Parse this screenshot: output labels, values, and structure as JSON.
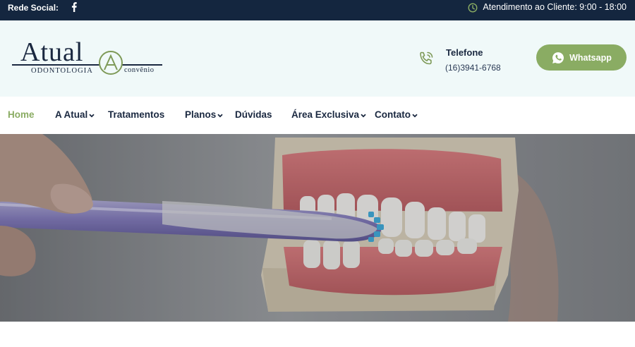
{
  "topbar": {
    "social_label": "Rede Social:",
    "social_icon": "facebook-icon",
    "support_icon": "clock-icon",
    "support_text": "Atendimento ao Cliente: 9:00 - 18:00"
  },
  "header": {
    "logo": {
      "brand": "Atual",
      "subtitle": "ODONTOLOGIA",
      "tagline": "convênio"
    },
    "phone": {
      "icon": "phone-icon",
      "title": "Telefone",
      "number": "(16)3941-6768"
    },
    "whatsapp": {
      "icon": "whatsapp-icon",
      "label": "Whatsapp"
    }
  },
  "nav": {
    "items": [
      {
        "label": "Home",
        "active": true,
        "dropdown": false
      },
      {
        "label": "A Atual",
        "active": false,
        "dropdown": true
      },
      {
        "label": "Tratamentos",
        "active": false,
        "dropdown": false
      },
      {
        "label": "Planos",
        "active": false,
        "dropdown": true
      },
      {
        "label": "Dúvidas",
        "active": false,
        "dropdown": false
      },
      {
        "label": "Área Exclusiva",
        "active": false,
        "dropdown": true
      },
      {
        "label": "Contato",
        "active": false,
        "dropdown": true
      }
    ]
  },
  "colors": {
    "topbar_bg": "#14263f",
    "header_bg": "#f0f9f9",
    "accent_green": "#8aac63",
    "navy": "#1a2840"
  }
}
